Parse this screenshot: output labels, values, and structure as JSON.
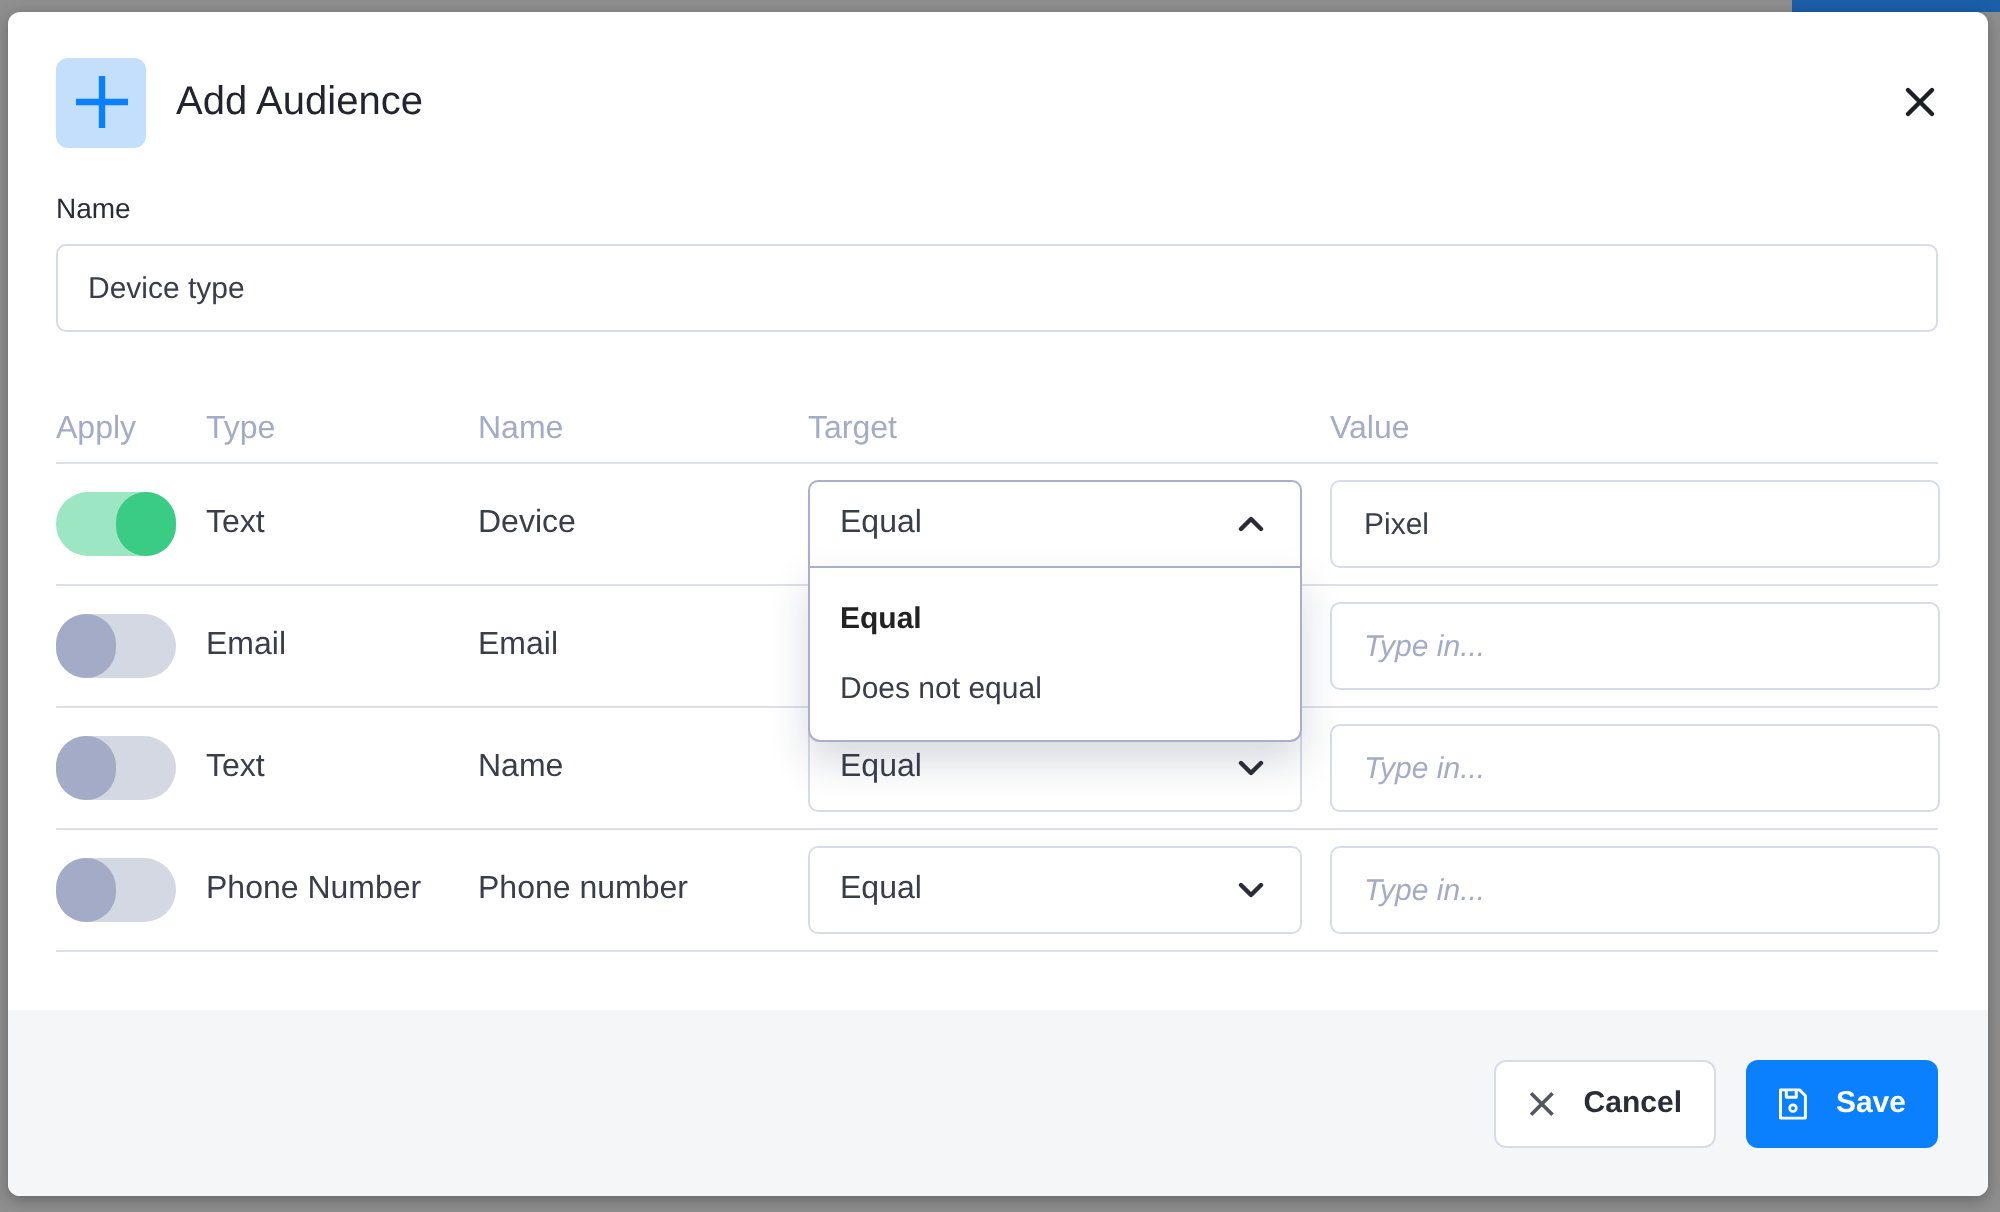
{
  "dialog": {
    "title": "Add Audience",
    "name_label": "Name",
    "name_value": "Device type"
  },
  "columns": [
    "Apply",
    "Type",
    "Name",
    "Target",
    "Value"
  ],
  "rows": [
    {
      "on": true,
      "type": "Text",
      "name": "Device",
      "target": "Equal",
      "expanded": true,
      "value": "Pixel"
    },
    {
      "on": false,
      "type": "Email",
      "name": "Email",
      "placeholder": "Type in..."
    },
    {
      "on": false,
      "type": "Text",
      "name": "Name",
      "target": "Equal",
      "expanded": false,
      "placeholder": "Type in..."
    },
    {
      "on": false,
      "type": "Phone Number",
      "name": "Phone number",
      "target": "Equal",
      "expanded": false,
      "placeholder": "Type in..."
    }
  ],
  "dropdown_options": [
    {
      "label": "Equal",
      "selected": true
    },
    {
      "label": "Does not equal",
      "selected": false
    }
  ],
  "buttons": [
    {
      "kind": "cancel",
      "label": "Cancel"
    },
    {
      "kind": "save",
      "label": "Save"
    }
  ]
}
